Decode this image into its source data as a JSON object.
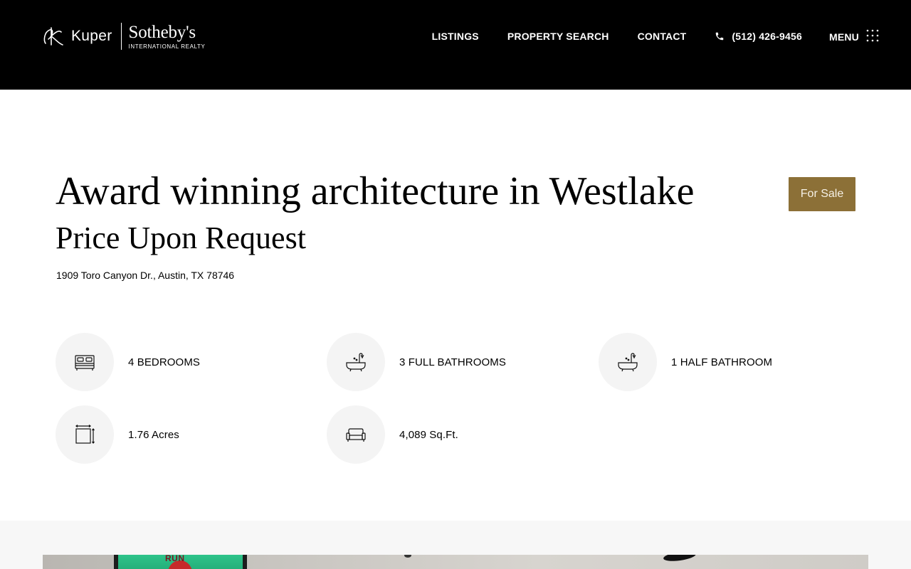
{
  "header": {
    "logo": {
      "kuper": "Kuper",
      "brand": "Sotheby's",
      "subtitle": "INTERNATIONAL REALTY"
    },
    "nav": {
      "listings": "LISTINGS",
      "property_search": "PROPERTY SEARCH",
      "contact": "CONTACT",
      "phone": "(512) 426-9456",
      "menu": "MENU"
    }
  },
  "listing": {
    "title": "Award winning architecture in Westlake",
    "price": "Price Upon Request",
    "address": "1909 Toro Canyon Dr., Austin, TX 78746",
    "status": "For Sale"
  },
  "features": [
    {
      "icon": "bed-icon",
      "label": "4 BEDROOMS"
    },
    {
      "icon": "bathtub-icon",
      "label": "3 FULL BATHROOMS"
    },
    {
      "icon": "bathtub-icon",
      "label": "1 HALF BATHROOM"
    },
    {
      "icon": "lot-size-icon",
      "label": "1.76 Acres"
    },
    {
      "icon": "sofa-icon",
      "label": "4,089 Sq.Ft."
    }
  ],
  "gallery": {
    "art_text": "RUN"
  },
  "colors": {
    "header_bg": "#000000",
    "badge_bg": "#8c7037",
    "feature_circle_bg": "#f4f4f4",
    "gallery_band_bg": "#f7f7f7"
  }
}
